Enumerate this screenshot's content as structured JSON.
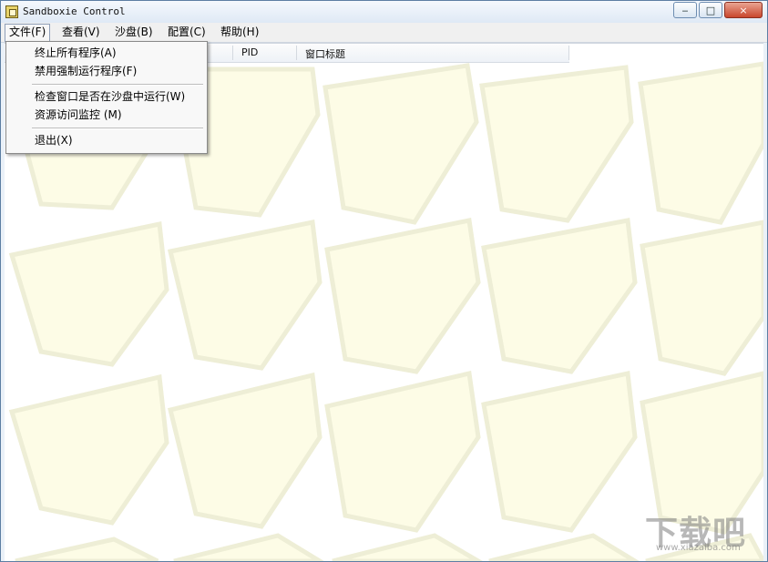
{
  "window": {
    "title": "Sandboxie Control",
    "caption_buttons": {
      "minimize": "‒",
      "maximize": "□",
      "close": "×"
    }
  },
  "menu": {
    "items": [
      {
        "label": "文件(F)",
        "state": "active"
      },
      {
        "label": "查看(V)"
      },
      {
        "label": "沙盘(B)"
      },
      {
        "label": "配置(C)"
      },
      {
        "label": "帮助(H)"
      }
    ],
    "file_menu": {
      "items": [
        "终止所有程序(A)",
        "禁用强制运行程序(F)",
        "检查窗口是否在沙盘中运行(W)",
        "资源访问监控 (M)",
        "退出(X)"
      ]
    }
  },
  "table": {
    "columns": [
      "PID",
      "窗口标题"
    ]
  },
  "watermark": {
    "main": "下载吧",
    "sub": "www.xiazaiba.com"
  },
  "colors": {
    "background_tile": "#fdfce6",
    "tile_border": "#f1f1dd",
    "window_border": "#5d7ea3"
  },
  "icons": {
    "app": "sandbox-app-icon",
    "close": "close-icon",
    "maximize": "maximize-icon",
    "minimize": "minimize-icon"
  }
}
